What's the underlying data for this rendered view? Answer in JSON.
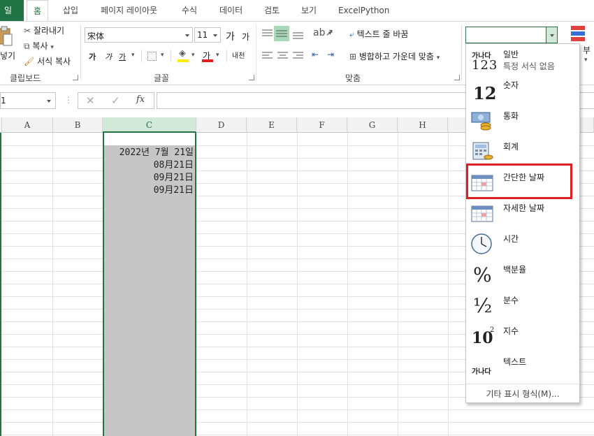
{
  "tabs": {
    "file": "일",
    "home": "홈",
    "insert": "삽입",
    "layout": "페이지 레이아웃",
    "formulas": "수식",
    "data": "데이터",
    "review": "검토",
    "view": "보기",
    "excelpython": "ExcelPython"
  },
  "clipboard": {
    "paste": "넣기",
    "cut": "잘라내기",
    "copy": "복사",
    "format_painter": "서식 복사",
    "label": "클립보드"
  },
  "font": {
    "name": "宋体",
    "size": "11",
    "grow": "가",
    "shrink": "가",
    "bold": "가",
    "italic": "가",
    "underline": "가",
    "font_color": "가",
    "phonetic": "내천",
    "label": "글꼴"
  },
  "alignment": {
    "wrap_text": "텍스트 줄 바꿈",
    "merge_center": "병합하고 가운데 맞춤",
    "label": "맞춤"
  },
  "number_format": {
    "current_value": ""
  },
  "right_edge": {
    "text": "부"
  },
  "formula_bar": {
    "namebox": "1",
    "cancel": "✕",
    "enter": "✓",
    "fx": "fx",
    "formula": ""
  },
  "columns": [
    "A",
    "B",
    "C",
    "D",
    "E",
    "F",
    "G",
    "H"
  ],
  "cells": {
    "c2": "2022년 7월 21일",
    "c3": "08月21日",
    "c4": "09月21日",
    "c5": "09月21日"
  },
  "dropdown": {
    "items": [
      {
        "label": "일반",
        "sub": "특정 서식 없음",
        "icon_text": "가나다",
        "icon_num": "123",
        "icon": "general-icon"
      },
      {
        "label": "숫자",
        "icon_text": "12",
        "icon": "number-icon"
      },
      {
        "label": "통화",
        "icon": "currency-icon"
      },
      {
        "label": "회계",
        "icon": "accounting-icon"
      },
      {
        "label": "간단한 날짜",
        "icon": "short-date-icon"
      },
      {
        "label": "자세한 날짜",
        "icon": "long-date-icon"
      },
      {
        "label": "시간",
        "icon": "clock-icon"
      },
      {
        "label": "백분율",
        "icon_text": "%",
        "icon": "percent-icon"
      },
      {
        "label": "분수",
        "icon_text": "½",
        "icon": "fraction-icon"
      },
      {
        "label": "지수",
        "icon_text": "10",
        "icon_sup": "2",
        "icon": "scientific-icon"
      },
      {
        "label": "텍스트",
        "icon_text": "가나다",
        "icon": "text-icon"
      }
    ],
    "more": "기타 표시 형식(M)..."
  },
  "colors": {
    "excel_green": "#217346",
    "highlight_red": "#e02020",
    "selection_gray": "#c6c6c6"
  }
}
